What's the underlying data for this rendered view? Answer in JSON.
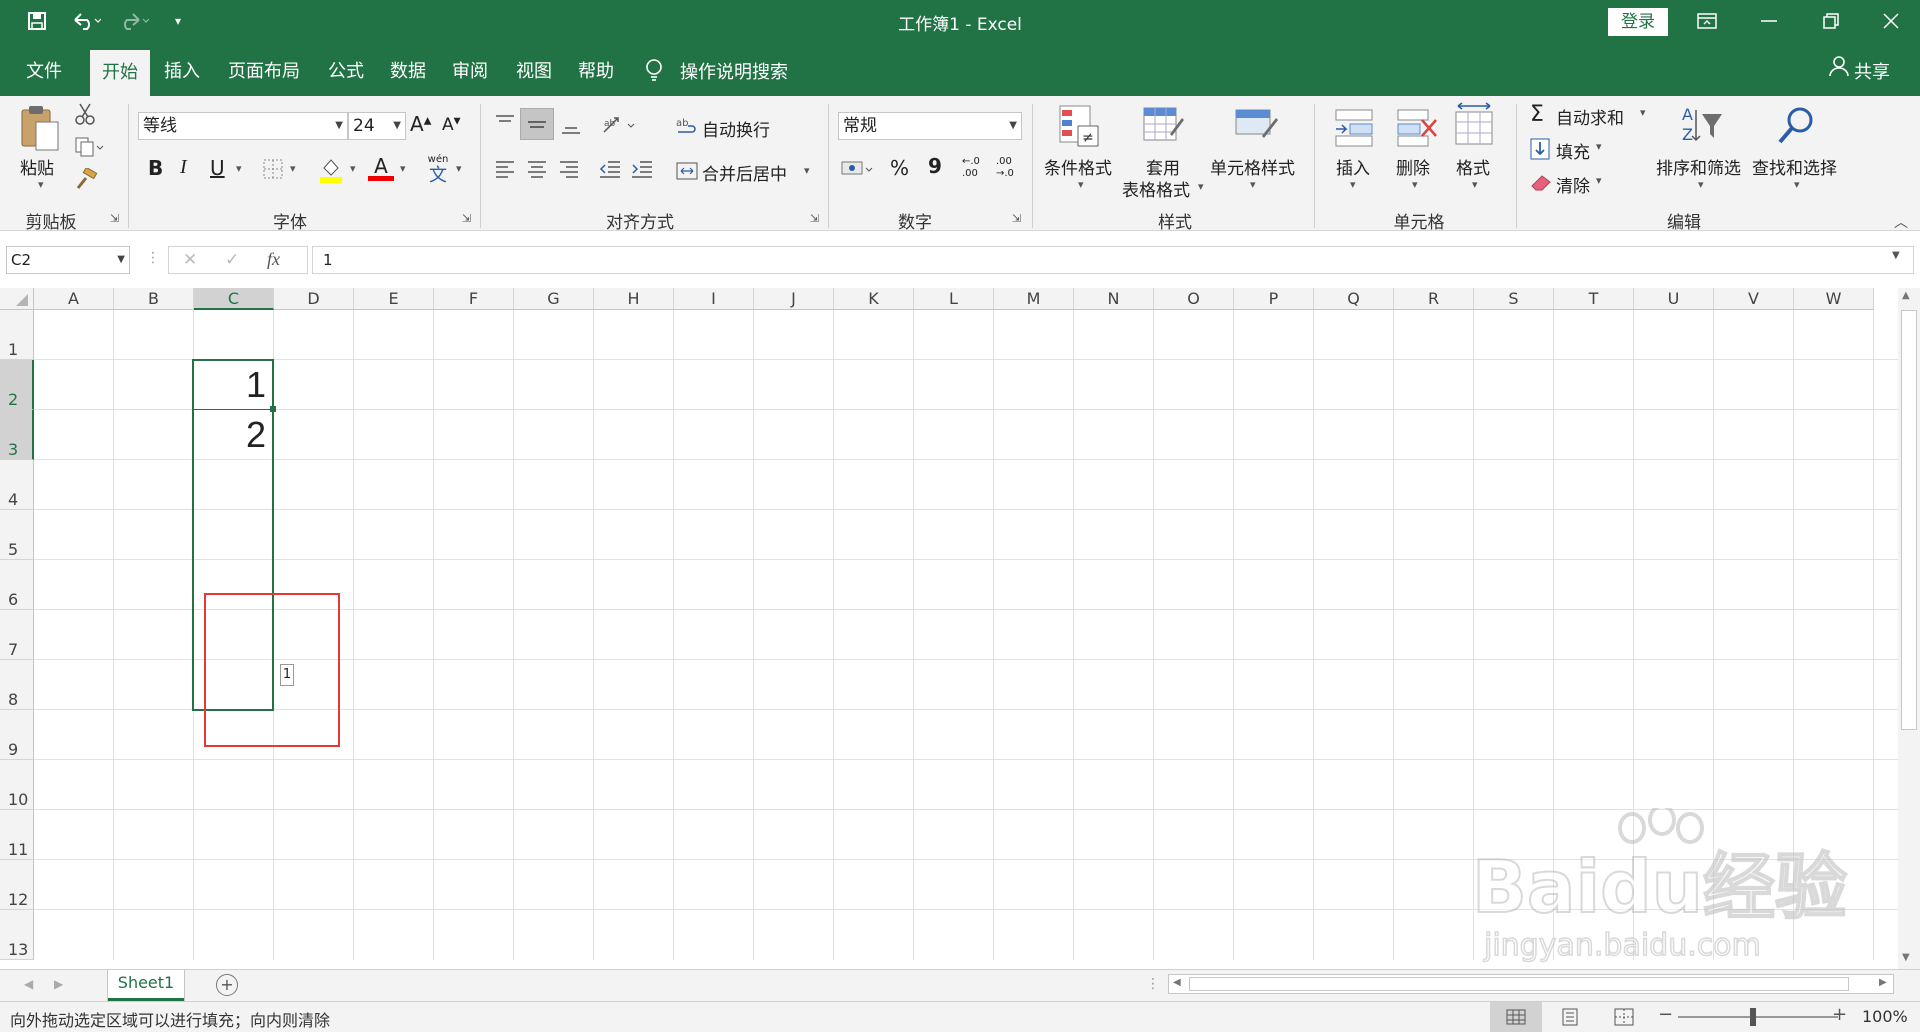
{
  "window": {
    "title": "工作簿1  -  Excel",
    "login_label": "登录",
    "share_label": "共享"
  },
  "tabs": [
    "文件",
    "开始",
    "插入",
    "页面布局",
    "公式",
    "数据",
    "审阅",
    "视图",
    "帮助"
  ],
  "active_tab": "开始",
  "tell_me": "操作说明搜索",
  "ribbon": {
    "clipboard": {
      "paste": "粘贴",
      "label": "剪贴板"
    },
    "font": {
      "name": "等线",
      "size": "24",
      "label": "字体",
      "bold": "B",
      "italic": "I",
      "underline": "U",
      "grow": "A",
      "shrink": "A",
      "phonetic_top": "wén",
      "phonetic_bottom": "文",
      "font_color_glyph": "A"
    },
    "alignment": {
      "wrap": "自动换行",
      "merge": "合并后居中",
      "label": "对齐方式"
    },
    "number": {
      "format": "常规",
      "percent": "%",
      "comma": "9",
      "inc_decimal_top": "←.0",
      "inc_decimal_bottom": ".00",
      "dec_decimal_top": ".00",
      "dec_decimal_bottom": "→.0",
      "label": "数字"
    },
    "styles": {
      "conditional": "条件格式",
      "table_line1": "套用",
      "table_line2": "表格格式",
      "cell_styles": "单元格样式",
      "label": "样式"
    },
    "cells": {
      "insert": "插入",
      "delete": "删除",
      "format": "格式",
      "label": "单元格"
    },
    "editing": {
      "autosum": "自动求和",
      "fill": "填充",
      "clear": "清除",
      "sort": "排序和筛选",
      "find": "查找和选择",
      "label": "编辑"
    }
  },
  "formula_bar": {
    "name_box": "C2",
    "fx": "fx",
    "value": "1"
  },
  "columns": [
    "A",
    "B",
    "C",
    "D",
    "E",
    "F",
    "G",
    "H",
    "I",
    "J",
    "K",
    "L",
    "M",
    "N",
    "O",
    "P",
    "Q",
    "R",
    "S",
    "T",
    "U",
    "V",
    "W"
  ],
  "rows": [
    "1",
    "2",
    "3",
    "4",
    "5",
    "6",
    "7",
    "8",
    "9",
    "10",
    "11",
    "12",
    "13"
  ],
  "cells": {
    "C2": "1",
    "C3": "2"
  },
  "fill_tooltip": "1",
  "sheet_tab": "Sheet1",
  "status": {
    "message": "向外拖动选定区域可以进行填充；向内则清除",
    "zoom": "100%"
  },
  "watermark": {
    "brand": "Baidu经验",
    "url": "jingyan.baidu.com"
  },
  "colors": {
    "excel_green": "#217346",
    "selection_green": "#217346",
    "drag_red": "#e53935"
  }
}
